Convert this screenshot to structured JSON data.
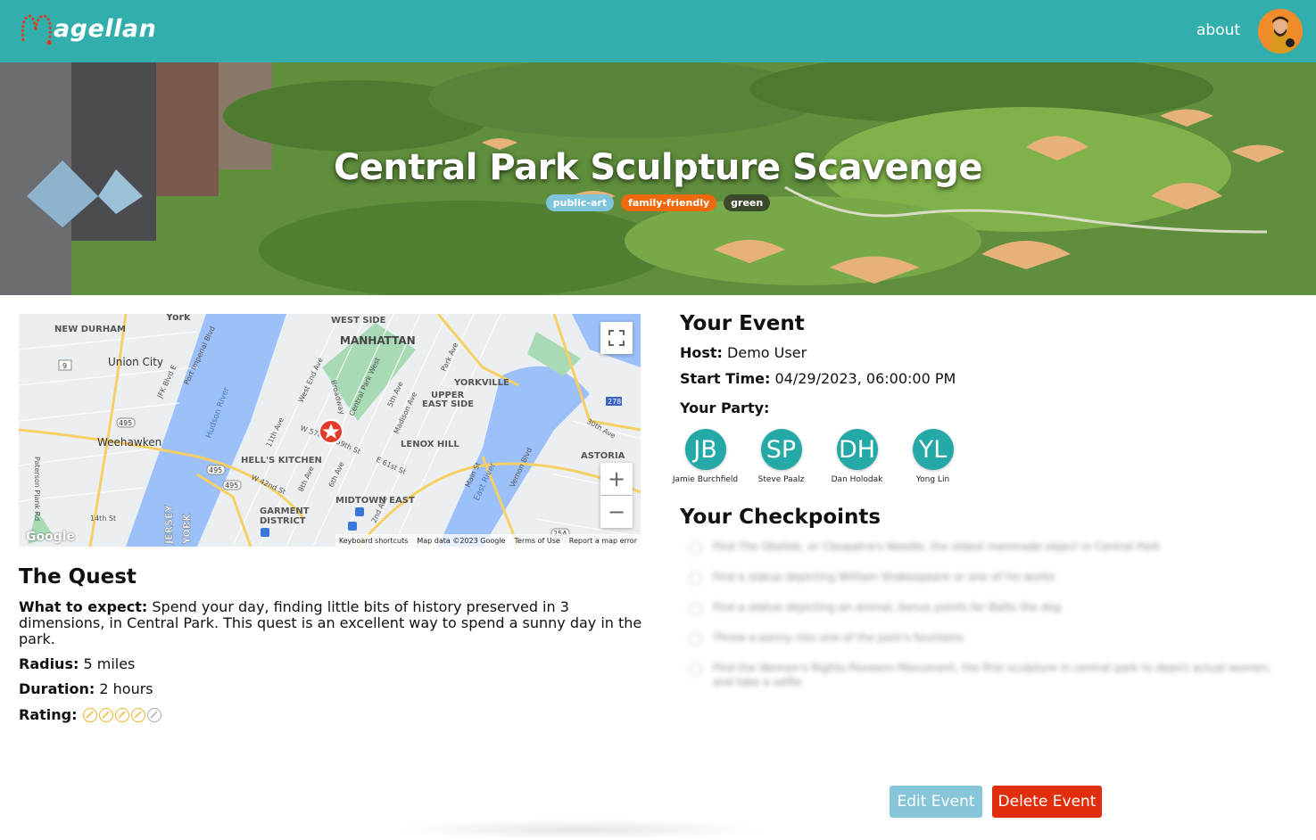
{
  "nav": {
    "logo_text": "agellan",
    "about_label": "about",
    "avatar_icon": "user-avatar-icon"
  },
  "hero": {
    "title": "Central Park Sculpture Scavenge",
    "tags": [
      {
        "label": "public-art",
        "color": "#7ec4da"
      },
      {
        "label": "family-friendly",
        "color": "#ef6a0c"
      },
      {
        "label": "green",
        "color": "#3b4a2a"
      }
    ]
  },
  "map": {
    "labels": {
      "york": "York",
      "new_durham": "NEW DURHAM",
      "west_side": "WEST SIDE",
      "manhattan": "MANHATTAN",
      "union_city": "Union City",
      "yorkville": "YORKVILLE",
      "upper_east_side_1": "UPPER",
      "upper_east_side_2": "EAST SIDE",
      "weehawken": "Weehawken",
      "lenox_hill": "LENOX HILL",
      "hells_kitchen": "HELL'S KITCHEN",
      "astoria": "ASTORIA",
      "midtown_east": "MIDTOWN EAST",
      "garment_1": "GARMENT",
      "garment_2": "DISTRICT",
      "hudson_river": "Hudson River",
      "east_river": "East River",
      "jersey": "JERSEY",
      "york_vert": "YORK",
      "route_9": "9",
      "route_495a": "495",
      "route_495b": "495",
      "route_495c": "495",
      "route_278": "278",
      "route_25a": "25A",
      "st_14": "14th St",
      "ave_30": "30th Ave",
      "st_w57": "W 57th St",
      "st_59": "59th St",
      "st_61": "E 61st St",
      "st_w42": "W 42nd St",
      "ave_11": "11th Ave",
      "ave_8": "8th Ave",
      "ave_6": "6th Ave",
      "ave_5": "5th Ave",
      "ave_madison": "Madison Ave",
      "cpw": "Central Park West",
      "broadway": "Broadway",
      "wea": "West End Ave",
      "park_ave": "Park Ave",
      "main_st": "Main St",
      "vernon": "Vernon Blvd",
      "jfk": "JFK Blvd E",
      "port_imp": "Port Imperial Blvd",
      "paterson": "Paterson Plank Rd",
      "ave_2nd": "2nd Ave"
    },
    "footer": {
      "shortcuts": "Keyboard shortcuts",
      "map_data": "Map data ©2023 Google",
      "terms": "Terms of Use",
      "report": "Report a map error"
    },
    "google_mark": "Google",
    "controls": {
      "fullscreen": "fullscreen-icon",
      "zoom_in": "+",
      "zoom_out": "−"
    }
  },
  "quest": {
    "title": "The Quest",
    "expect_label": "What to expect:",
    "expect_text": "Spend your day, finding little bits of history preserved in 3 dimensions, in Central Park. This quest is an excellent way to spend a sunny day in the park.",
    "radius_label": "Radius:",
    "radius_value": "5 miles",
    "duration_label": "Duration:",
    "duration_value": "2 hours",
    "rating_label": "Rating:",
    "rating_value": 4,
    "rating_max": 5
  },
  "event": {
    "title": "Your Event",
    "host_label": "Host:",
    "host_value": "Demo User",
    "start_label": "Start Time:",
    "start_value": "04/29/2023, 06:00:00 PM",
    "party_label": "Your Party:",
    "party": [
      {
        "initials": "JB",
        "name": "Jamie Burchfield"
      },
      {
        "initials": "SP",
        "name": "Steve Paalz"
      },
      {
        "initials": "DH",
        "name": "Dan Holodak"
      },
      {
        "initials": "YL",
        "name": "Yong Lin"
      }
    ]
  },
  "checkpoints": {
    "title": "Your Checkpoints",
    "items": [
      "Find The Obelisk, or Cleopatra's Needle, the oldest manmade object in Central Park",
      "Find a statue depicting William Shakespeare or one of his works",
      "Find a statue depicting an animal, bonus points for Balto the dog",
      "Throw a penny into one of the park's fountains",
      "Find the Women's Rights Pioneers Monument, the first sculpture in central park to depict actual women, and take a selfie"
    ]
  },
  "actions": {
    "edit_label": "Edit Event",
    "delete_label": "Delete Event"
  }
}
